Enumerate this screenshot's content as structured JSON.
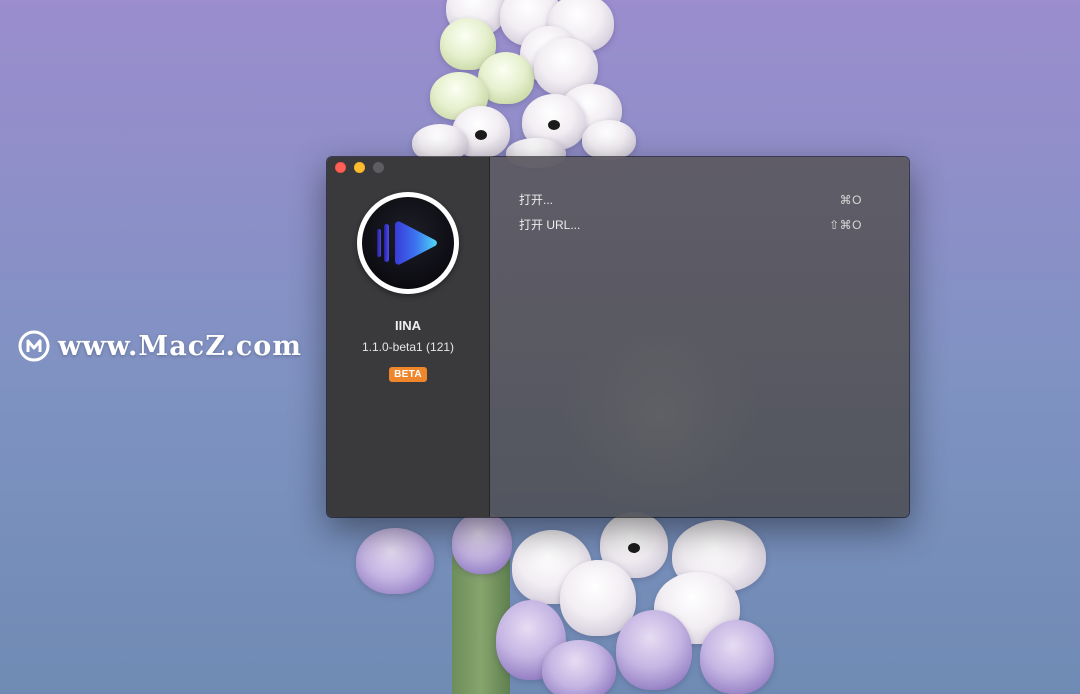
{
  "watermark": {
    "text": "www.MacZ.com"
  },
  "window": {
    "controls": {
      "close": "close-button",
      "minimize": "minimize-button",
      "zoom": "zoom-button"
    },
    "colors": {
      "close": "#fe5f57",
      "minimize": "#febc2e",
      "zoom_disabled": "#5d5d62",
      "beta_badge": "#f0862b"
    }
  },
  "sidebar": {
    "app_icon": "iina-play-icon",
    "app_name": "IINA",
    "version": "1.1.0-beta1 (121)",
    "badge": "BETA"
  },
  "menu": {
    "items": [
      {
        "label": "打开...",
        "shortcut": "⌘O"
      },
      {
        "label": "打开 URL...",
        "shortcut": "⇧⌘O"
      }
    ]
  }
}
